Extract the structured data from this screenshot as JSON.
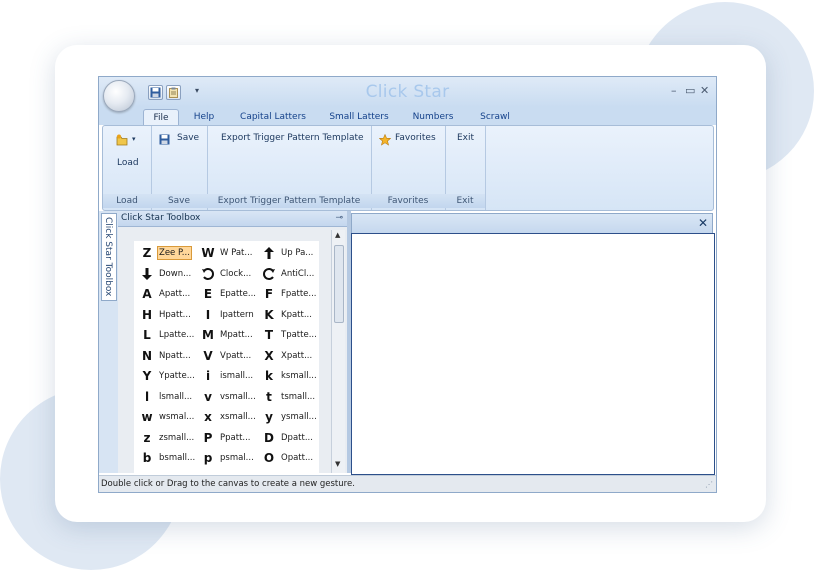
{
  "app": {
    "title": "Click Star"
  },
  "quick_access": {
    "more_label": "▾"
  },
  "window_controls": {
    "minimize": "–",
    "maximize": "▭",
    "close": "✕"
  },
  "tabs": [
    {
      "label": "File",
      "active": true
    },
    {
      "label": "Help"
    },
    {
      "label": "Capital Latters"
    },
    {
      "label": "Small Latters"
    },
    {
      "label": "Numbers"
    },
    {
      "label": "Scrawl"
    }
  ],
  "ribbon": {
    "groups": [
      {
        "label": "Load",
        "button": "Load"
      },
      {
        "label": "Save",
        "button": "Save"
      },
      {
        "label": "Export Trigger Pattern Template",
        "button": "Export Trigger Pattern Template"
      },
      {
        "label": "Favorites",
        "button": "Favorites"
      },
      {
        "label": "Exit",
        "button": "Exit"
      }
    ]
  },
  "side_tab": {
    "label": "Click Star Toolbox"
  },
  "toolbox": {
    "title": "Click Star Toolbox",
    "pin_icon": "pin-icon",
    "items": [
      {
        "glyph": "Z",
        "label": "Zee P...",
        "selected": true
      },
      {
        "glyph": "W",
        "label": "W Pat..."
      },
      {
        "glyph": "",
        "label": "Up Pa...",
        "icon": "up-arrow-icon"
      },
      {
        "glyph": "",
        "label": "Down...",
        "icon": "down-arrow-icon"
      },
      {
        "glyph": "",
        "label": "Clock...",
        "icon": "clockwise-icon"
      },
      {
        "glyph": "",
        "label": "AntiCl...",
        "icon": "anticlockwise-icon"
      },
      {
        "glyph": "A",
        "label": "Apatt..."
      },
      {
        "glyph": "E",
        "label": "Epatte..."
      },
      {
        "glyph": "F",
        "label": "Fpatte..."
      },
      {
        "glyph": "H",
        "label": "Hpatt..."
      },
      {
        "glyph": "I",
        "label": "Ipattern"
      },
      {
        "glyph": "K",
        "label": "Kpatt..."
      },
      {
        "glyph": "L",
        "label": "Lpatte..."
      },
      {
        "glyph": "M",
        "label": "Mpatt..."
      },
      {
        "glyph": "T",
        "label": "Tpatte..."
      },
      {
        "glyph": "N",
        "label": "Npatt..."
      },
      {
        "glyph": "V",
        "label": "Vpatt..."
      },
      {
        "glyph": "X",
        "label": "Xpatt..."
      },
      {
        "glyph": "Y",
        "label": "Ypatte..."
      },
      {
        "glyph": "i",
        "label": "ismall..."
      },
      {
        "glyph": "k",
        "label": "ksmall..."
      },
      {
        "glyph": "l",
        "label": "lsmall..."
      },
      {
        "glyph": "v",
        "label": "vsmall..."
      },
      {
        "glyph": "t",
        "label": "tsmall..."
      },
      {
        "glyph": "w",
        "label": "wsmal..."
      },
      {
        "glyph": "x",
        "label": "xsmall..."
      },
      {
        "glyph": "y",
        "label": "ysmall..."
      },
      {
        "glyph": "z",
        "label": "zsmall..."
      },
      {
        "glyph": "P",
        "label": "Ppatt..."
      },
      {
        "glyph": "D",
        "label": "Dpatt..."
      },
      {
        "glyph": "b",
        "label": "bsmall..."
      },
      {
        "glyph": "p",
        "label": "psmal..."
      },
      {
        "glyph": "O",
        "label": "Opatt..."
      }
    ]
  },
  "canvas": {
    "close_icon": "close-icon"
  },
  "status": {
    "text": "Double click or Drag to the canvas to create a new gesture."
  },
  "colors": {
    "accent": "#15428b",
    "title_text": "#a8c8ec",
    "selection": "#ffd79a"
  }
}
